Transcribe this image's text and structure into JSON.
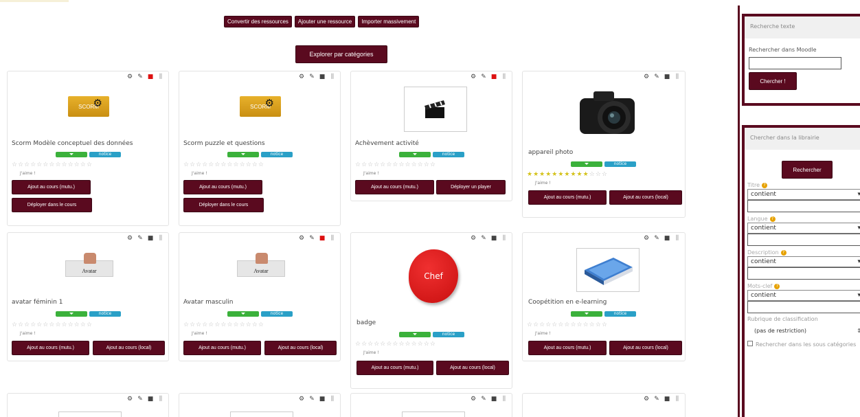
{
  "toolbar": {
    "convert": "Convertir des ressources",
    "add": "Ajouter une ressource",
    "import": "Importer massivement",
    "explore": "Explorer par catégories"
  },
  "cards": [
    {
      "title": "Scorm Modèle conceptuel des données",
      "thumb_text": "SCORM",
      "btn1": "Ajout au cours (mutu.)",
      "btn2": "Déployer dans le cours",
      "rating": 0
    },
    {
      "title": "Scorm puzzle et questions",
      "thumb_text": "SCORM",
      "btn1": "Ajout au cours (mutu.)",
      "btn2": "Déployer dans le cours",
      "rating": 0
    },
    {
      "title": "Achèvement activité",
      "btn1": "Ajout au cours (mutu.)",
      "btn2": "Déployer un player",
      "rating": 0
    },
    {
      "title": "appareil photo",
      "btn1": "Ajout au cours (mutu.)",
      "btn2": "Ajout au cours (local)",
      "rating": 10
    },
    {
      "title": "avatar féminin 1",
      "thumb_text": "Avatar",
      "btn1": "Ajout au cours (mutu.)",
      "btn2": "Ajout au cours (local)",
      "rating": 0
    },
    {
      "title": "Avatar masculin",
      "thumb_text": "Avatar",
      "btn1": "Ajout au cours (mutu.)",
      "btn2": "Ajout au cours (local)",
      "rating": 0
    },
    {
      "title": "badge",
      "thumb_text": "Chef",
      "btn1": "Ajout au cours (mutu.)",
      "btn2": "Ajout au cours (local)",
      "rating": 0
    },
    {
      "title": "Coopétition en e-learning",
      "btn1": "Ajout au cours (mutu.)",
      "btn2": "Ajout au cours (local)",
      "rating": 0
    }
  ],
  "notice_label": "notice",
  "like_label": "J'aime !",
  "stars_total": 13,
  "sidebar": {
    "text_search": {
      "header": "Recherche texte",
      "label": "Rechercher dans Moodle",
      "button": "Chercher !"
    },
    "library": {
      "header": "Chercher dans la librairie",
      "button": "Rechercher",
      "fields": [
        {
          "label": "Titre",
          "operator": "contient"
        },
        {
          "label": "Langue",
          "operator": "contient"
        },
        {
          "label": "Description",
          "operator": "contient"
        },
        {
          "label": "Mots-clef",
          "operator": "contient"
        }
      ],
      "classification_label": "Rubrique de classification",
      "classification_value": "(pas de restriction)",
      "subcat_label": "Rechercher dans les sous catégories"
    }
  },
  "colors": {
    "accent": "#5a0a1f",
    "green": "#3bb13b",
    "blue": "#2aa0c7"
  }
}
